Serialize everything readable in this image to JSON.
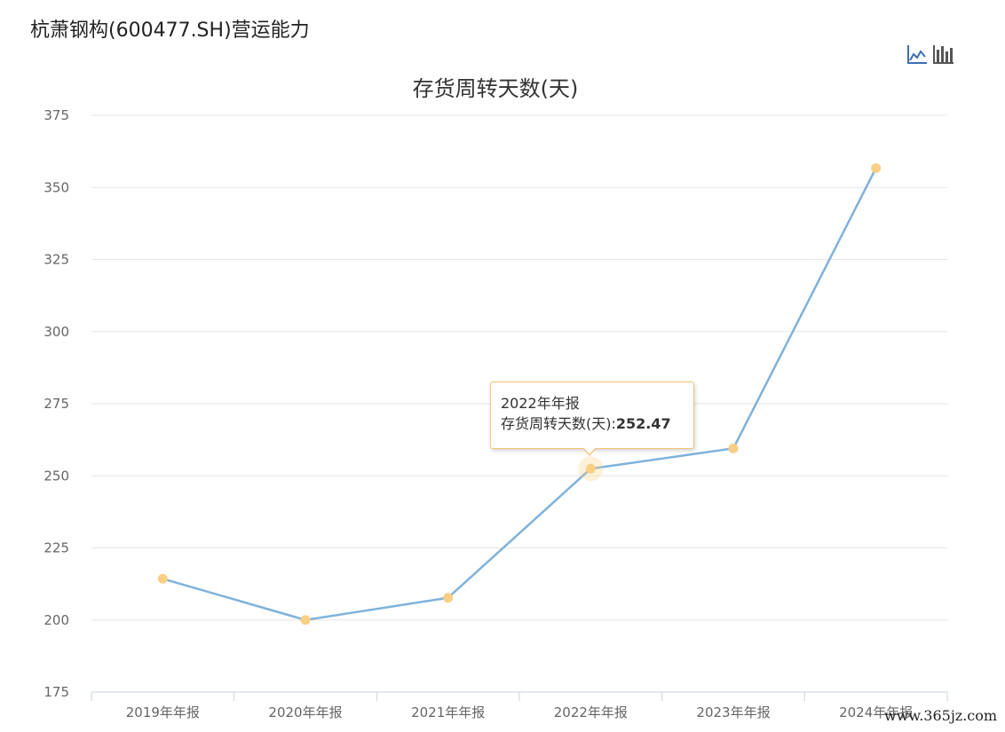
{
  "page": {
    "title": "杭萧钢构(600477.SH)营运能力"
  },
  "toolbar": {
    "line_icon": "line-chart-icon",
    "bar_icon": "bar-chart-icon"
  },
  "chart_data": {
    "type": "line",
    "title": "存货周转天数(天)",
    "xlabel": "",
    "ylabel": "",
    "categories": [
      "2019年年报",
      "2020年年报",
      "2021年年报",
      "2022年年报",
      "2023年年报",
      "2024年年报"
    ],
    "series": [
      {
        "name": "存货周转天数(天)",
        "values": [
          214.3,
          200.0,
          207.7,
          252.47,
          259.5,
          356.7
        ]
      }
    ],
    "ylim": [
      175,
      375
    ],
    "yticks": [
      175,
      200,
      225,
      250,
      275,
      300,
      325,
      350,
      375
    ],
    "grid": true,
    "legend": "none",
    "colors": {
      "line": "#7fb2db",
      "marker": "#f9cf85",
      "grid": "#e6e6e6",
      "axis": "#c8d3e0",
      "tick_text": "#666666"
    }
  },
  "tooltip": {
    "category": "2022年年报",
    "series_label": "存货周转天数(天):",
    "value": "252.47"
  },
  "watermark": "www.365jz.com"
}
